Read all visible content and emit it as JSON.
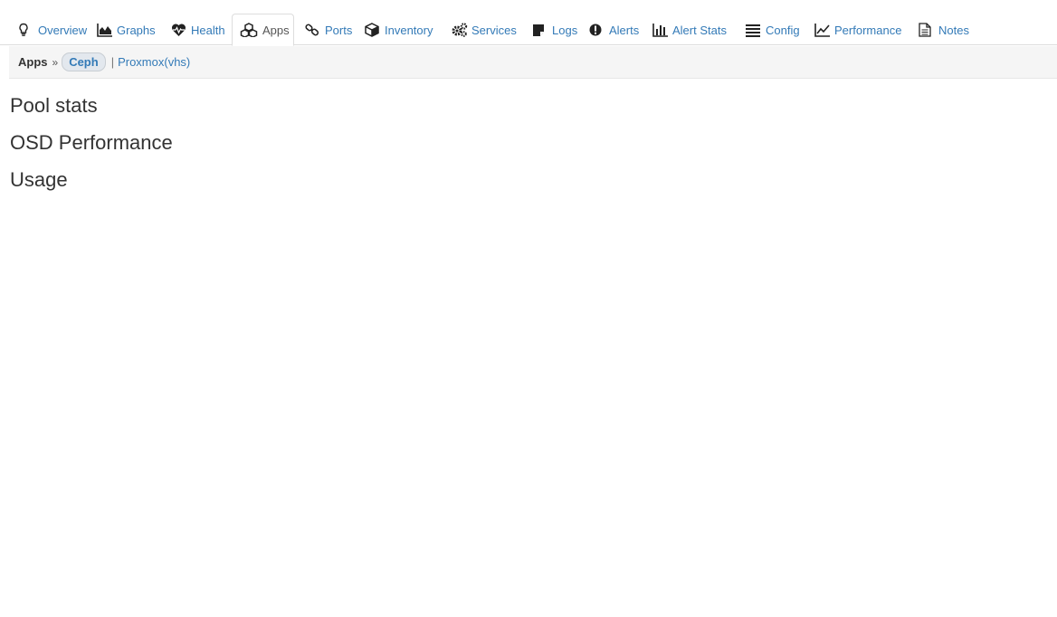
{
  "tabs": [
    {
      "label": "Overview",
      "icon": "lightbulb-icon"
    },
    {
      "label": "Graphs",
      "icon": "area-chart-icon"
    },
    {
      "label": "Health",
      "icon": "heartbeat-icon"
    },
    {
      "label": "Apps",
      "icon": "cubes-icon",
      "active": true
    },
    {
      "label": "Ports",
      "icon": "link-icon"
    },
    {
      "label": "Inventory",
      "icon": "cube-icon"
    },
    {
      "label": "Services",
      "icon": "cogs-icon"
    },
    {
      "label": "Logs",
      "icon": "sticky-note-icon"
    },
    {
      "label": "Alerts",
      "icon": "exclamation-circle-icon"
    },
    {
      "label": "Alert Stats",
      "icon": "bar-chart-icon"
    },
    {
      "label": "Config",
      "icon": "align-justify-icon"
    },
    {
      "label": "Performance",
      "icon": "line-chart-icon"
    },
    {
      "label": "Notes",
      "icon": "file-text-icon"
    }
  ],
  "breadcrumb": {
    "root": "Apps",
    "separator": "»",
    "active": "Ceph",
    "pipe": "|",
    "other": "Proxmox(vhs)"
  },
  "sections": [
    "Pool stats",
    "OSD Performance",
    "Usage"
  ],
  "colors": {
    "link": "#337ab7",
    "text": "#333333",
    "crumb_bg": "#f5f5f5",
    "pill_bg": "#e3e8ee"
  }
}
